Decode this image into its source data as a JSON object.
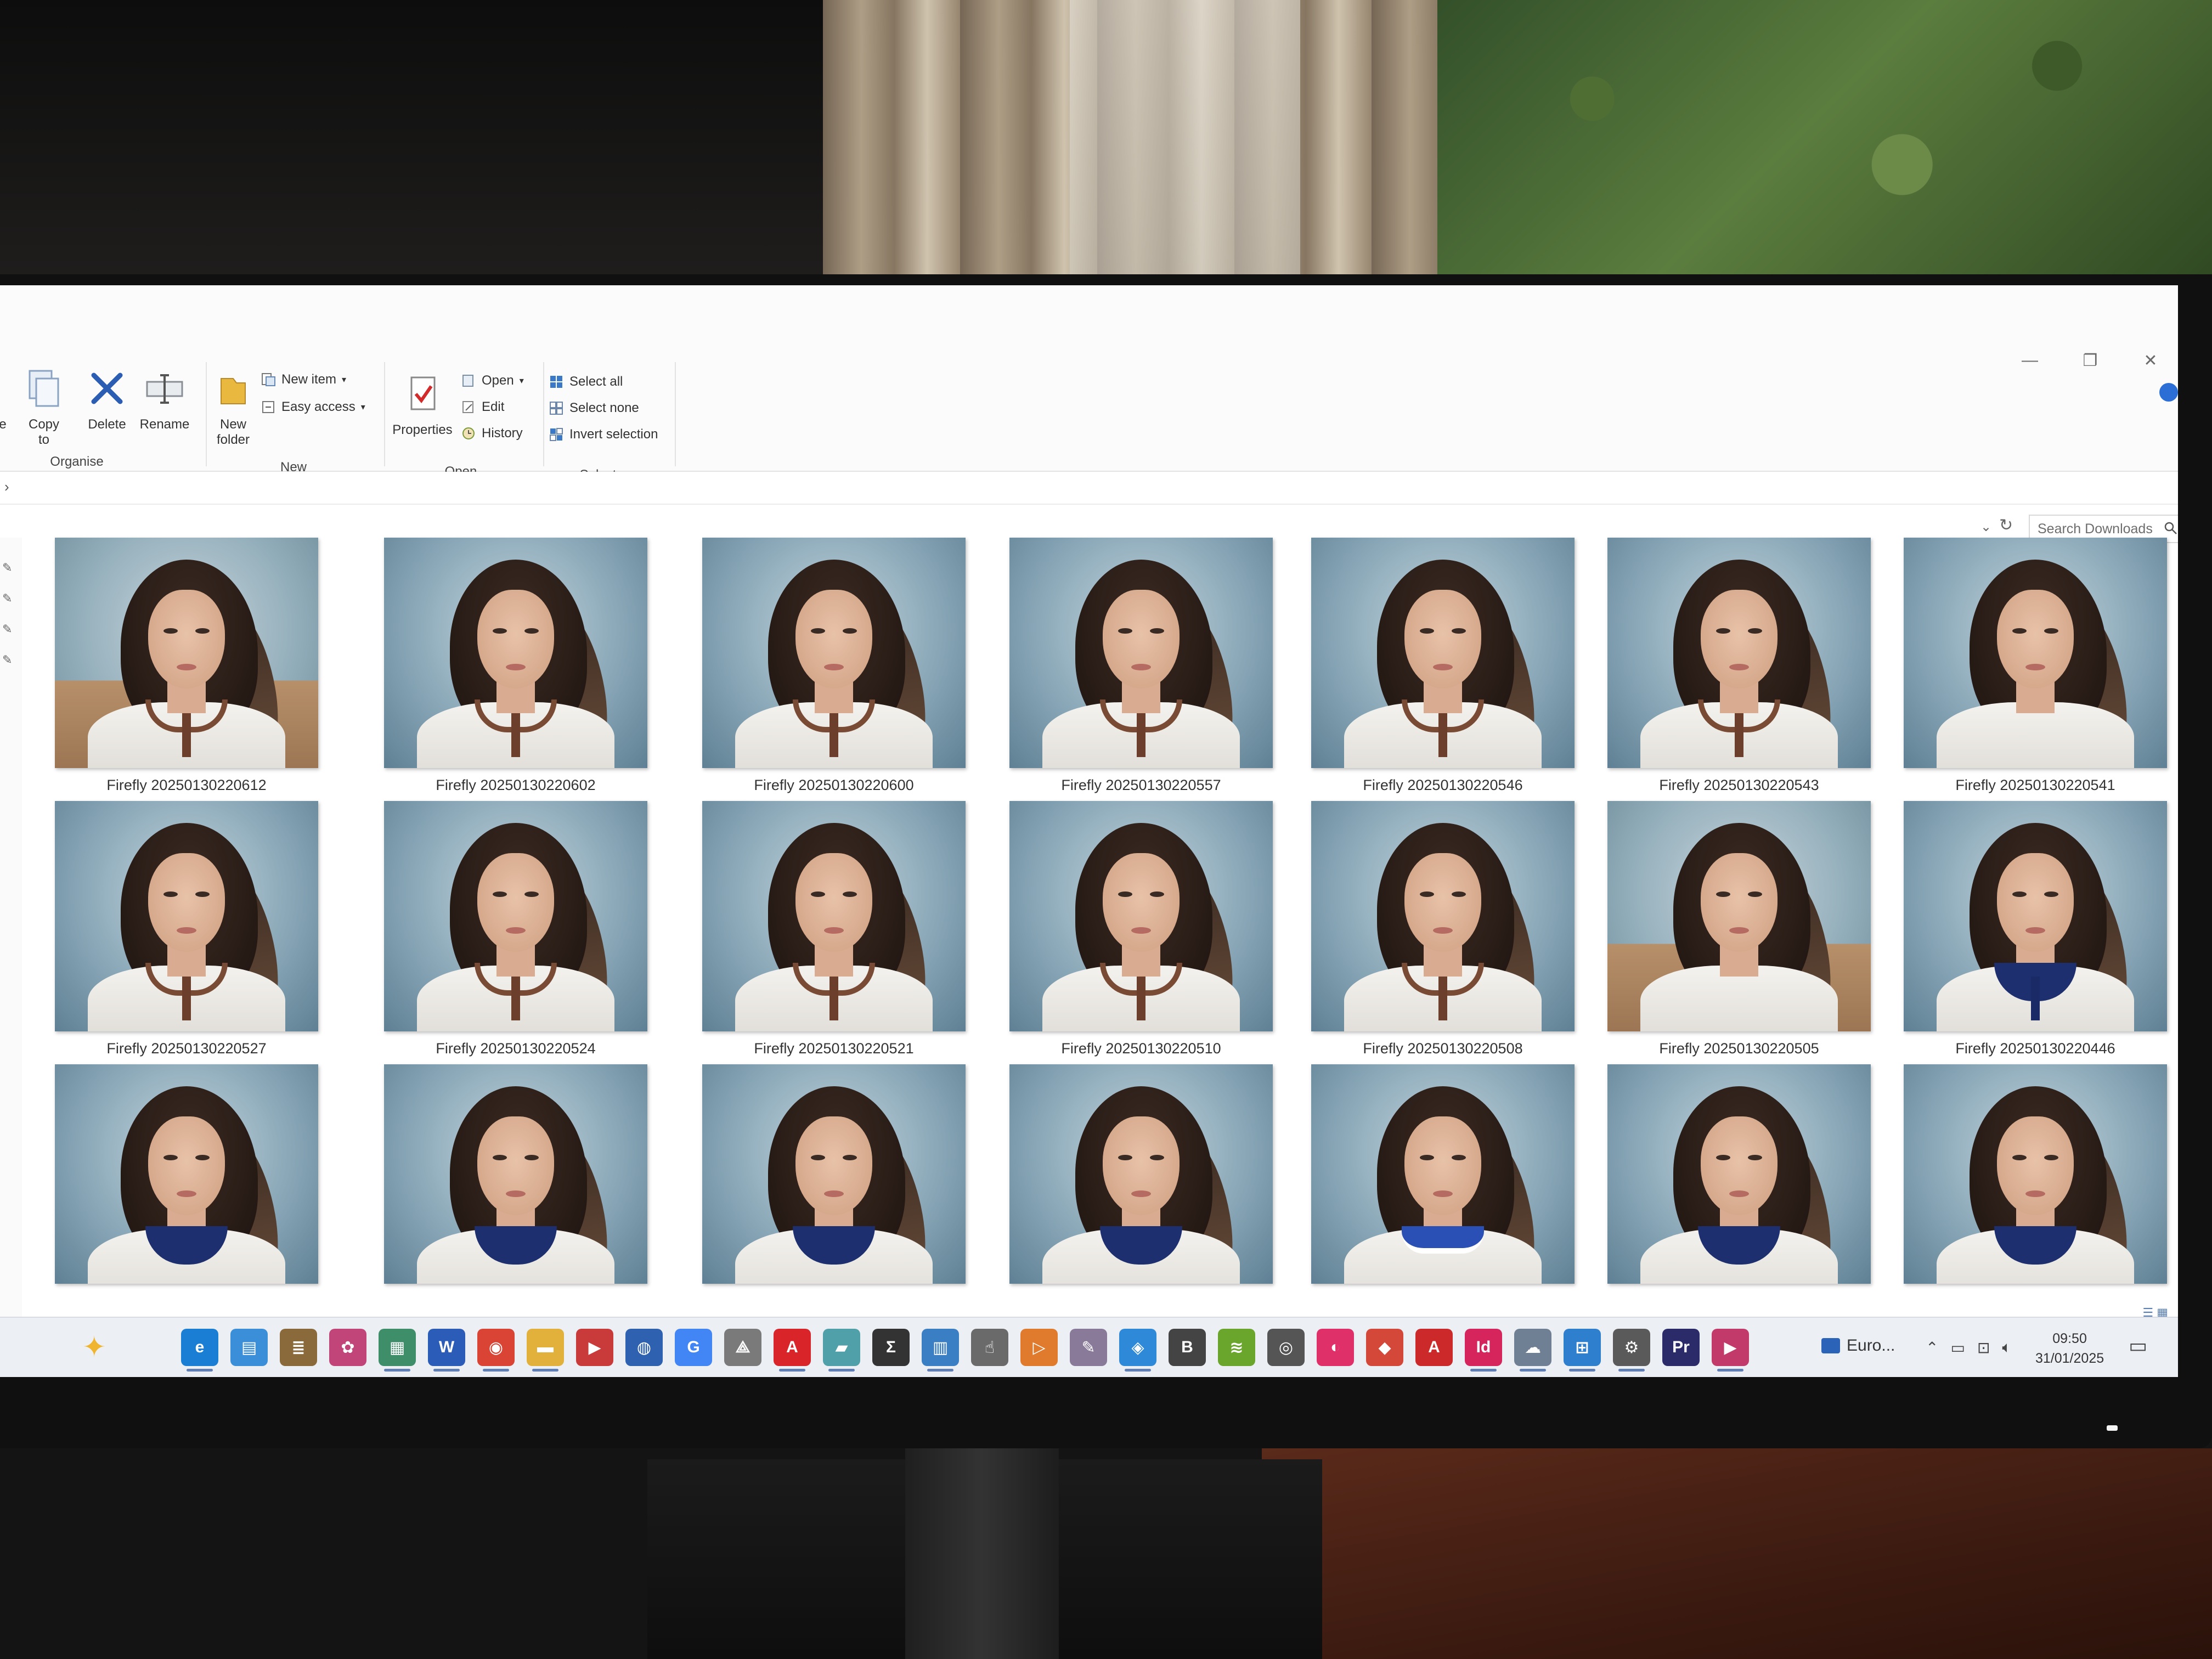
{
  "ribbon": {
    "organise": {
      "label": "Organise",
      "cut_partial": "e",
      "copy_to": "Copy\nto",
      "delete": "Delete",
      "rename": "Rename"
    },
    "new": {
      "label": "New",
      "new_folder": "New\nfolder",
      "new_item": "New item",
      "easy_access": "Easy access"
    },
    "open": {
      "label": "Open",
      "properties": "Properties",
      "open": "Open",
      "edit": "Edit",
      "history": "History"
    },
    "select": {
      "label": "Select",
      "select_all": "Select all",
      "select_none": "Select none",
      "invert_selection": "Invert selection"
    }
  },
  "search": {
    "placeholder": "Search Downloads"
  },
  "files": [
    {
      "name": "Firefly 20250130220612",
      "collar": "brown",
      "bg": "warm"
    },
    {
      "name": "Firefly 20250130220602",
      "collar": "brown",
      "bg": "cool"
    },
    {
      "name": "Firefly 20250130220600",
      "collar": "brown",
      "bg": "cool"
    },
    {
      "name": "Firefly 20250130220557",
      "collar": "brown",
      "bg": "cool"
    },
    {
      "name": "Firefly 20250130220546",
      "collar": "brown",
      "bg": "cool"
    },
    {
      "name": "Firefly 20250130220543",
      "collar": "brown",
      "bg": "cool"
    },
    {
      "name": "Firefly 20250130220541",
      "collar": "none",
      "bg": "cool"
    },
    {
      "name": "Firefly 20250130220527",
      "collar": "brown",
      "bg": "cool"
    },
    {
      "name": "Firefly 20250130220524",
      "collar": "brown",
      "bg": "cool"
    },
    {
      "name": "Firefly 20250130220521",
      "collar": "brown",
      "bg": "cool"
    },
    {
      "name": "Firefly 20250130220510",
      "collar": "brown",
      "bg": "cool"
    },
    {
      "name": "Firefly 20250130220508",
      "collar": "brown",
      "bg": "cool"
    },
    {
      "name": "Firefly 20250130220505",
      "collar": "none",
      "bg": "warm"
    },
    {
      "name": "Firefly 20250130220446",
      "collar": "navy-tie",
      "bg": "cool"
    },
    {
      "name": "",
      "collar": "navy",
      "bg": "cool"
    },
    {
      "name": "",
      "collar": "navy",
      "bg": "cool"
    },
    {
      "name": "",
      "collar": "navy",
      "bg": "cool"
    },
    {
      "name": "",
      "collar": "navy",
      "bg": "cool"
    },
    {
      "name": "",
      "collar": "stripe",
      "bg": "cool"
    },
    {
      "name": "",
      "collar": "navy",
      "bg": "cool"
    },
    {
      "name": "",
      "collar": "navy",
      "bg": "cool"
    }
  ],
  "taskbar": {
    "apps": [
      {
        "icon": "edge-icon",
        "color": "#1a7fd4",
        "glyph": "e",
        "active": true
      },
      {
        "icon": "news-icon",
        "color": "#3a8fd8",
        "glyph": "▤",
        "active": false
      },
      {
        "icon": "stack-icon",
        "color": "#8a6a3a",
        "glyph": "≣",
        "active": false
      },
      {
        "icon": "photos-icon",
        "color": "#c2457a",
        "glyph": "✿",
        "active": false
      },
      {
        "icon": "gallery-icon",
        "color": "#3e8e6a",
        "glyph": "▦",
        "active": true
      },
      {
        "icon": "word-icon",
        "color": "#2b5cb8",
        "glyph": "W",
        "active": true
      },
      {
        "icon": "chrome-icon",
        "color": "#d94434",
        "glyph": "◉",
        "active": true
      },
      {
        "icon": "file-explorer-icon",
        "color": "#e2b13c",
        "glyph": "▬",
        "active": true
      },
      {
        "icon": "media-icon",
        "color": "#c93a3a",
        "glyph": "▶",
        "active": false
      },
      {
        "icon": "app-circle-icon",
        "color": "#2e62b0",
        "glyph": "◍",
        "active": false
      },
      {
        "icon": "google-icon",
        "color": "#4285f4",
        "glyph": "G",
        "active": false
      },
      {
        "icon": "pdf-viewer-icon",
        "color": "#7a7a7a",
        "glyph": "⟁",
        "active": false
      },
      {
        "icon": "acrobat-icon",
        "color": "#d9252a",
        "glyph": "A",
        "active": true
      },
      {
        "icon": "notes-icon",
        "color": "#4fa0a8",
        "glyph": "▰",
        "active": true
      },
      {
        "icon": "sigma-icon",
        "color": "#333333",
        "glyph": "Σ",
        "active": false
      },
      {
        "icon": "calculator-icon",
        "color": "#3a7ec4",
        "glyph": "▥",
        "active": true
      },
      {
        "icon": "hand-icon",
        "color": "#6a6a6a",
        "glyph": "☝",
        "active": false
      },
      {
        "icon": "video-icon",
        "color": "#e07a2c",
        "glyph": "▷",
        "active": false
      },
      {
        "icon": "paint-icon",
        "color": "#8a7a9a",
        "glyph": "✎",
        "active": false
      },
      {
        "icon": "photo-viewer-icon",
        "color": "#2e8ad8",
        "glyph": "◈",
        "active": true
      },
      {
        "icon": "bold-b-icon",
        "color": "#444444",
        "glyph": "B",
        "active": false
      },
      {
        "icon": "nvidia-icon",
        "color": "#6aa52c",
        "glyph": "≋",
        "active": false
      },
      {
        "icon": "audio-icon",
        "color": "#555555",
        "glyph": "◎",
        "active": false
      },
      {
        "icon": "creative-cloud-icon",
        "color": "#e0306a",
        "glyph": "◐",
        "active": false
      },
      {
        "icon": "shapes-icon",
        "color": "#d4483a",
        "glyph": "◆",
        "active": false
      },
      {
        "icon": "acrobat-alt-icon",
        "color": "#cc2a2a",
        "glyph": "A",
        "active": false
      },
      {
        "icon": "indesign-icon",
        "color": "#d6245c",
        "glyph": "Id",
        "active": true
      },
      {
        "icon": "cloud-drive-icon",
        "color": "#6f7f94",
        "glyph": "☁",
        "active": true
      },
      {
        "icon": "teams-icon",
        "color": "#2f7fcf",
        "glyph": "⊞",
        "active": true
      },
      {
        "icon": "settings-icon",
        "color": "#5a5a5a",
        "glyph": "⚙",
        "active": true
      },
      {
        "icon": "premiere-icon",
        "color": "#2b2b6a",
        "glyph": "Pr",
        "active": false
      },
      {
        "icon": "player-icon",
        "color": "#c23a6a",
        "glyph": "▶",
        "active": true
      }
    ],
    "weather_label": "Euro...",
    "clock_time": "09:50",
    "clock_date": "31/01/2025"
  }
}
